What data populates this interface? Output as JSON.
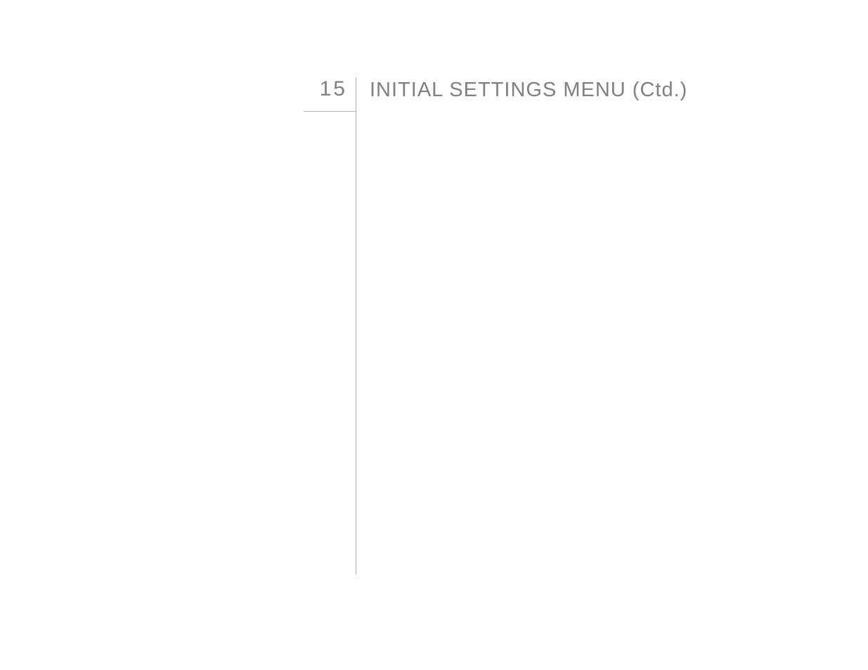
{
  "header": {
    "section_number": "15",
    "section_title": "INITIAL SETTINGS MENU (Ctd.)"
  }
}
